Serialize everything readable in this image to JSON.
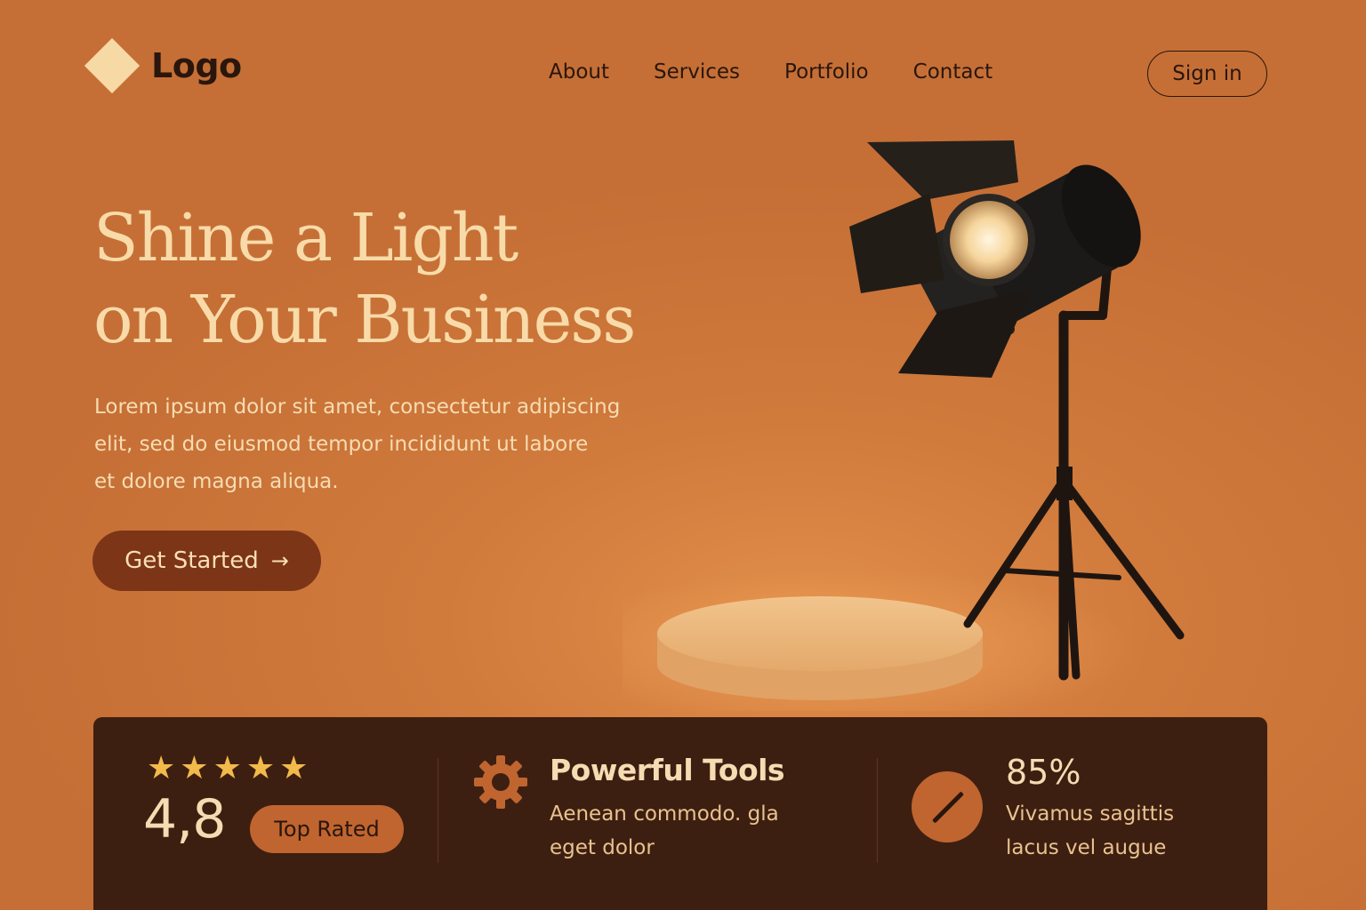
{
  "header": {
    "logo_text": "Logo",
    "nav": [
      "About",
      "Services",
      "Portfolio",
      "Contact"
    ],
    "signin_label": "Sign in"
  },
  "hero": {
    "title_lines": [
      "Shine a Light",
      "on Your Business"
    ],
    "body_lines": [
      "Lorem ipsum dolor sit amet, consectetur adipiscing",
      "elit, sed do eiusmod tempor incididunt ut labore",
      "et dolore magna aliqua."
    ],
    "cta_label": "Get Started",
    "cta_icon": "arrow-right-icon"
  },
  "stats": {
    "rating": {
      "stars": 5,
      "value": "4,8",
      "badge": "Top Rated"
    },
    "tools": {
      "icon": "gear-icon",
      "title": "Powerful Tools",
      "text_lines": [
        "Aenean commodo.  gla",
        "eget dolor"
      ]
    },
    "percent": {
      "icon": "slash-circle-icon",
      "value": "85%",
      "text_lines": [
        "Vivamus sagittis",
        "lacus vel augue"
      ]
    }
  },
  "colors": {
    "background": "#cf7a3c",
    "accent_light": "#f8dba8",
    "cta": "#7c3517",
    "panel": "#3d1f11",
    "star": "#f2b94b",
    "badge": "#c0652f"
  }
}
